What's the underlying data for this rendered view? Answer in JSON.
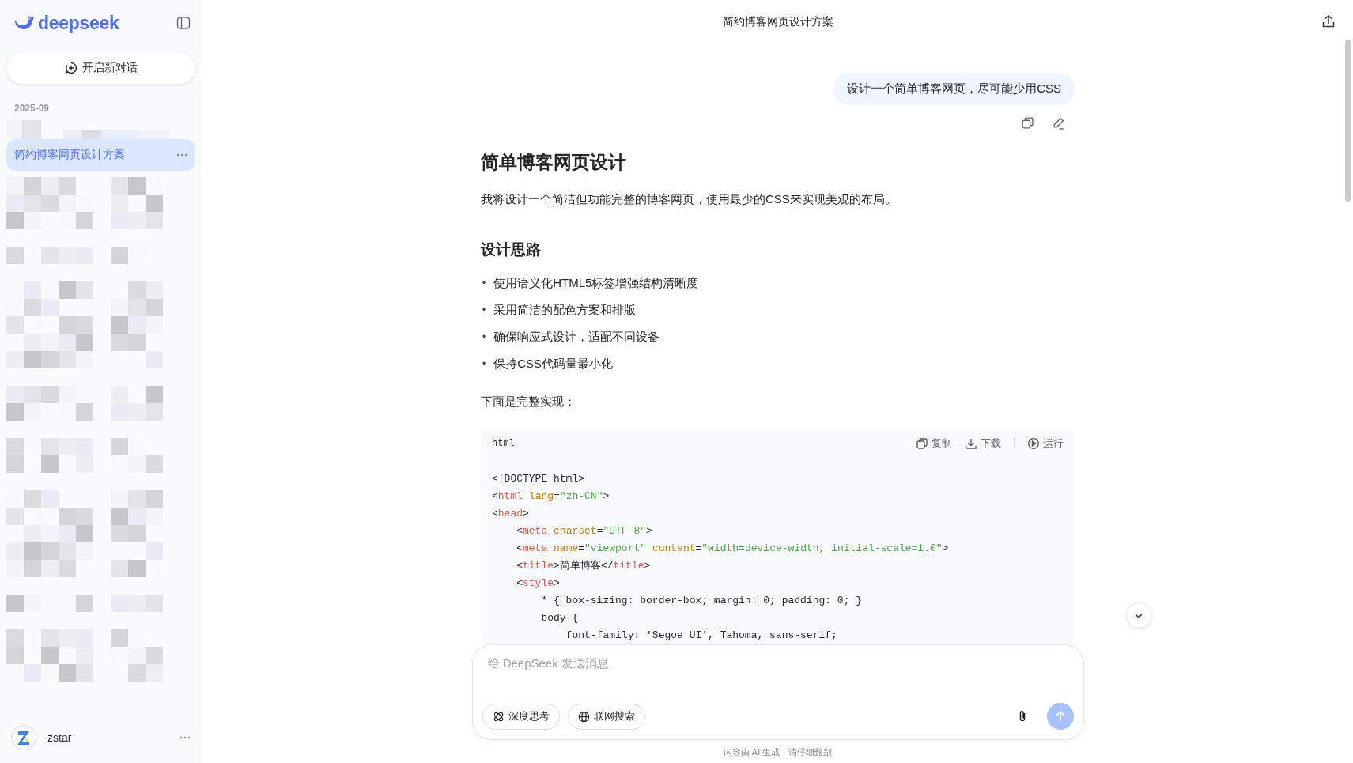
{
  "sidebar": {
    "logo": "deepseek",
    "new_chat": "开启新对话",
    "groups": [
      {
        "date": "2025-09",
        "items": [
          {
            "title": "简约博客网页设计方案",
            "selected": true
          }
        ]
      }
    ],
    "user": {
      "name": "zstar"
    }
  },
  "header": {
    "title": "简约博客网页设计方案"
  },
  "user_message": {
    "text": "设计一个简单博客网页，尽可能少用CSS"
  },
  "answer": [
    {
      "kind": "h1",
      "text": "简单博客网页设计"
    },
    {
      "kind": "p",
      "text": "我将设计一个简洁但功能完整的博客网页，使用最少的CSS来实现美观的布局。"
    },
    {
      "kind": "h2",
      "text": "设计思路"
    },
    {
      "kind": "list",
      "marker": "•",
      "items": [
        "使用语义化HTML5标签增强结构清晰度",
        "采用简洁的配色方案和排版",
        "确保响应式设计，适配不同设备",
        "保持CSS代码量最小化"
      ]
    },
    {
      "kind": "p",
      "text": "下面是完整实现："
    },
    {
      "kind": "code",
      "language": "html",
      "actions": [
        "复制",
        "下载",
        "运行"
      ],
      "lines": [
        [
          {
            "kind": "plain",
            "s": "<!DOCTYPE html>"
          }
        ],
        [
          {
            "kind": "plain",
            "s": "<"
          },
          {
            "kind": "tag",
            "s": "html"
          },
          {
            "kind": "attr",
            "s": " lang"
          },
          {
            "kind": "plain",
            "s": "="
          },
          {
            "kind": "str",
            "s": "\"zh-CN\""
          },
          {
            "kind": "plain",
            "s": ">"
          }
        ],
        [
          {
            "kind": "plain",
            "s": "<"
          },
          {
            "kind": "tag",
            "s": "head"
          },
          {
            "kind": "plain",
            "s": ">"
          }
        ],
        [
          {
            "kind": "plain",
            "s": "    <"
          },
          {
            "kind": "tag",
            "s": "meta"
          },
          {
            "kind": "attr",
            "s": " charset"
          },
          {
            "kind": "plain",
            "s": "="
          },
          {
            "kind": "str",
            "s": "\"UTF-8\""
          },
          {
            "kind": "plain",
            "s": ">"
          }
        ],
        [
          {
            "kind": "plain",
            "s": "    <"
          },
          {
            "kind": "tag",
            "s": "meta"
          },
          {
            "kind": "attr",
            "s": " name"
          },
          {
            "kind": "plain",
            "s": "="
          },
          {
            "kind": "str",
            "s": "\"viewport\""
          },
          {
            "kind": "attr",
            "s": " content"
          },
          {
            "kind": "plain",
            "s": "="
          },
          {
            "kind": "str",
            "s": "\"width=device-width, initial-scale=1.0\""
          },
          {
            "kind": "plain",
            "s": ">"
          }
        ],
        [
          {
            "kind": "plain",
            "s": "    <"
          },
          {
            "kind": "tag",
            "s": "title"
          },
          {
            "kind": "plain",
            "s": ">简单博客</"
          },
          {
            "kind": "tag",
            "s": "title"
          },
          {
            "kind": "plain",
            "s": ">"
          }
        ],
        [
          {
            "kind": "plain",
            "s": "    <"
          },
          {
            "kind": "tag",
            "s": "style"
          },
          {
            "kind": "plain",
            "s": ">"
          }
        ],
        [
          {
            "kind": "plain",
            "s": "        * { box-sizing: border-box; margin: 0; padding: 0; }"
          }
        ],
        [
          {
            "kind": "plain",
            "s": "        body {"
          }
        ],
        [
          {
            "kind": "plain",
            "s": "            font-family: 'Segoe UI', Tahoma, sans-serif;"
          }
        ]
      ]
    }
  ],
  "composer": {
    "placeholder": "给 DeepSeek 发送消息",
    "toggles": [
      {
        "label": "深度思考",
        "selected": false
      },
      {
        "label": "联网搜索",
        "selected": false
      }
    ],
    "send_disabled": true
  },
  "footer": "内容由 AI 生成，请仔细甄别"
}
